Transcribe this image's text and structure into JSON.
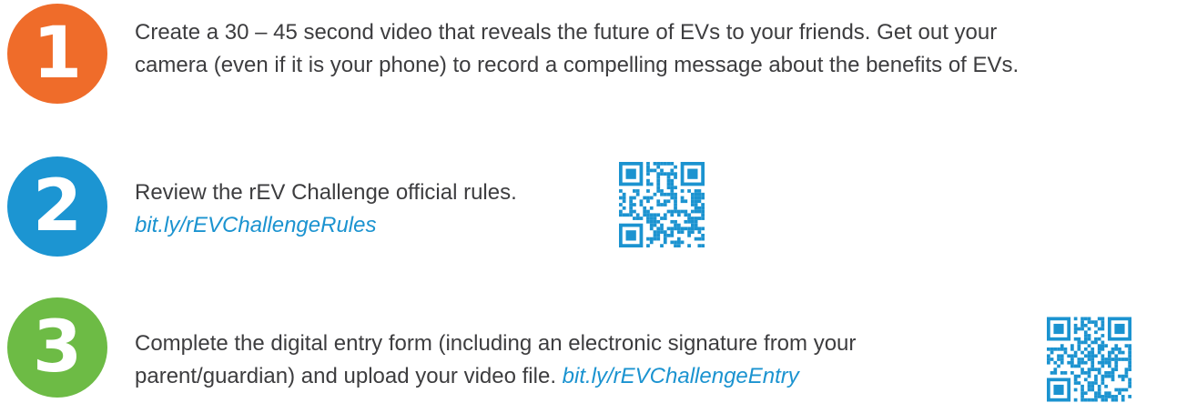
{
  "steps": [
    {
      "number": "1",
      "color": "#ef6c2a",
      "lines": [
        "Create a 30 – 45 second video that reveals the future of EVs to your friends. Get out your",
        "camera (even if it is your phone) to record a compelling message about the benefits of EVs."
      ]
    },
    {
      "number": "2",
      "color": "#1c95d2",
      "lines": [
        "Review the rEV Challenge official rules."
      ],
      "link": "bit.ly/rEVChallengeRules",
      "qr_icon": "qr-code-icon"
    },
    {
      "number": "3",
      "color": "#6dbb45",
      "lines": [
        "Complete the digital entry form (including an electronic signature from your",
        "parent/guardian) and upload your video file."
      ],
      "link": "bit.ly/rEVChallengeEntry",
      "qr_icon": "qr-code-icon"
    }
  ],
  "qr_color": "#1b93d0"
}
